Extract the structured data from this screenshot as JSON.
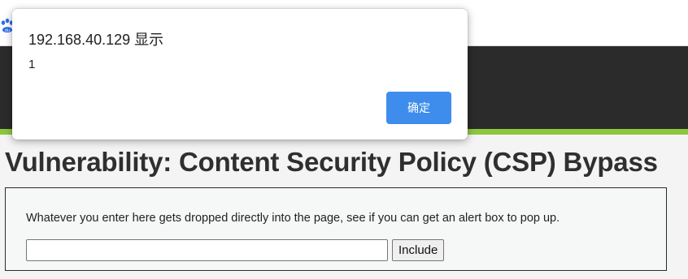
{
  "browser": {
    "tab_fragment": "",
    "bookmark_icon": "baidu-paw-icon"
  },
  "page": {
    "title": "Vulnerability: Content Security Policy (CSP) Bypass",
    "instructions": "Whatever you enter here gets dropped directly into the page, see if you can get an alert box to pop up.",
    "input_value": "",
    "include_label": "Include"
  },
  "alert": {
    "title": "192.168.40.129 显示",
    "message": "1",
    "ok_label": "确定"
  },
  "colors": {
    "header_bg": "#2b2b2b",
    "accent_green": "#8dc63f",
    "alert_button": "#3e8ded"
  }
}
